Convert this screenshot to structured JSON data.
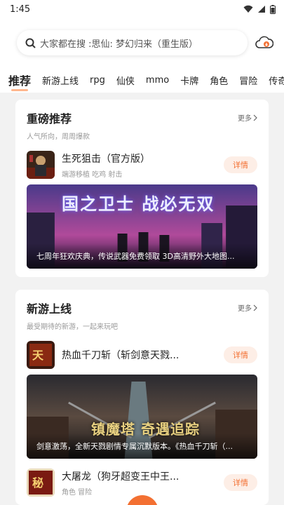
{
  "status": {
    "time": "1:45"
  },
  "search": {
    "placeholder": "大家都在搜 :思仙: 梦幻归来（重生版）"
  },
  "tabs": [
    "推荐",
    "新游上线",
    "rpg",
    "仙侠",
    "mmo",
    "卡牌",
    "角色",
    "冒险",
    "传奇"
  ],
  "sections": [
    {
      "title": "重磅推荐",
      "subtitle": "人气所向，周周爆款",
      "more": "更多",
      "game": {
        "name": "生死狙击（官方版）",
        "tags": "端游移植 吃鸡 射击",
        "button": "详情"
      },
      "banner": {
        "caption": "七周年狂欢庆典，传说武器免费领取 3D高清野外大地图...",
        "art_text": "国之卫士 战必无双"
      }
    },
    {
      "title": "新游上线",
      "subtitle": "最受期待的新游，一起来玩吧",
      "more": "更多",
      "game": {
        "name": "热血千刀斩（斩剑意天戮...",
        "tags": "",
        "button": "详情"
      },
      "banner": {
        "caption": "剑意激荡，全新天戮剧情专属沉默版本。《热血千刀斩（...",
        "art_text": "镇魔塔 奇遇追踪"
      }
    }
  ],
  "extra_game": {
    "name": "大屠龙（狗牙超变王中王...",
    "tags": "角色 冒险",
    "button": "详情"
  },
  "colors": {
    "accent": "#f37032",
    "accent_bg": "#fdeee6"
  }
}
